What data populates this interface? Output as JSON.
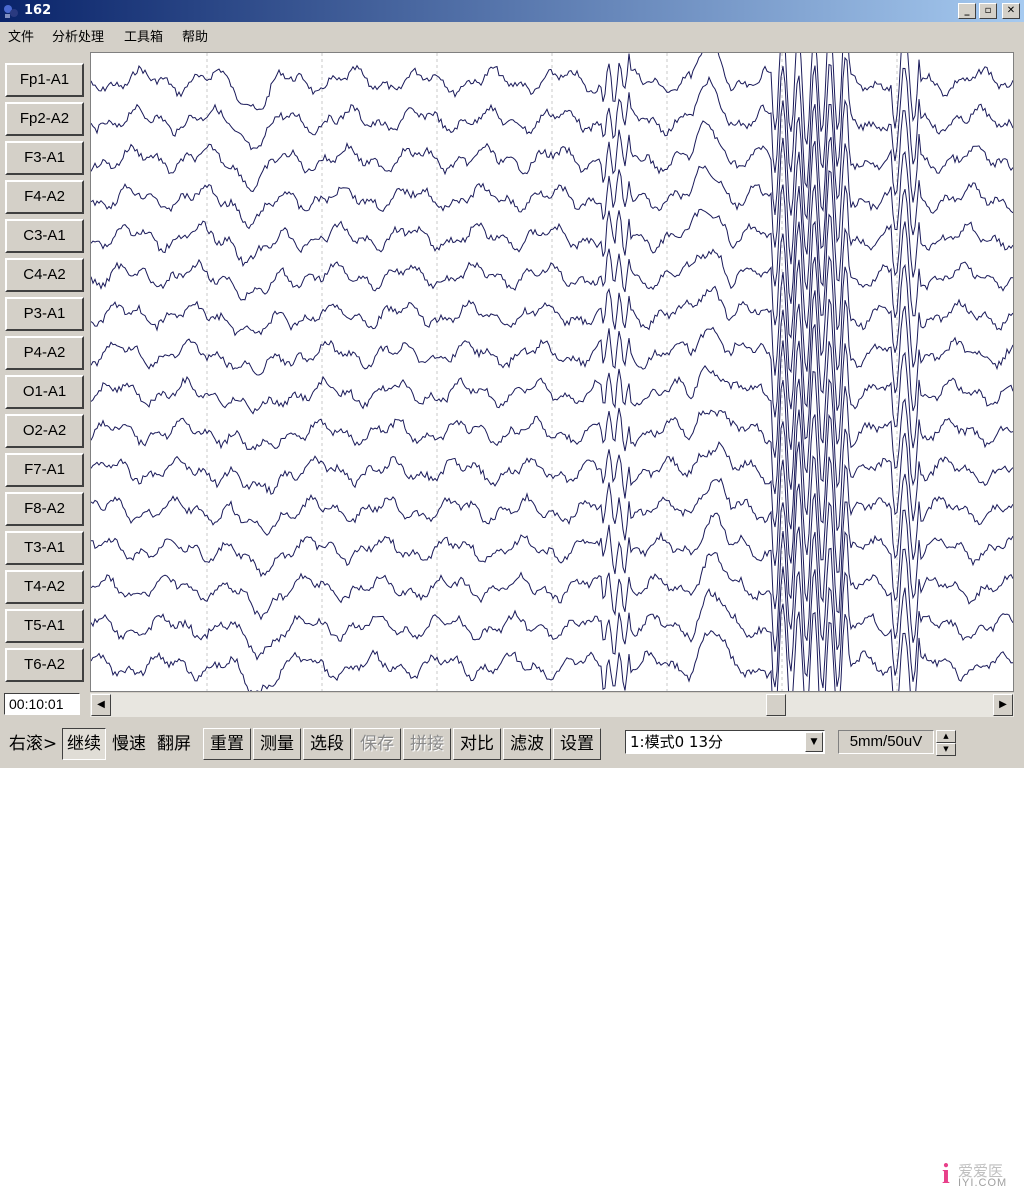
{
  "window": {
    "title": "162",
    "minimize": "_",
    "restore": "▫",
    "close": "✕"
  },
  "menu": [
    "文件",
    "分析处理",
    "工具箱",
    "帮助"
  ],
  "channels": [
    "Fp1-A1",
    "Fp2-A2",
    "F3-A1",
    "F4-A2",
    "C3-A1",
    "C4-A2",
    "P3-A1",
    "P4-A2",
    "O1-A1",
    "O2-A2",
    "F7-A1",
    "F8-A2",
    "T3-A1",
    "T4-A2",
    "T5-A1",
    "T6-A2"
  ],
  "time": "00:10:01",
  "scroll_position": 0.76,
  "toolbar": {
    "scroll_right": "右滚>",
    "continue": "继续",
    "slow": "慢速",
    "flip_screen": "翻屏",
    "reset": "重置",
    "measure": "测量",
    "select_segment": "选段",
    "save": "保存",
    "splice": "拼接",
    "compare": "对比",
    "filter": "滤波",
    "settings": "设置"
  },
  "mode_select": "1:模式0    13分",
  "scale": "5mm/50uV",
  "watermark": {
    "logo": "i",
    "name": "爱爱医",
    "site": "IYI.COM"
  },
  "colors": {
    "trace": "#1a1a5a",
    "titlebar_start": "#0a246a",
    "titlebar_end": "#a6caf0",
    "face": "#d4d0c8"
  }
}
